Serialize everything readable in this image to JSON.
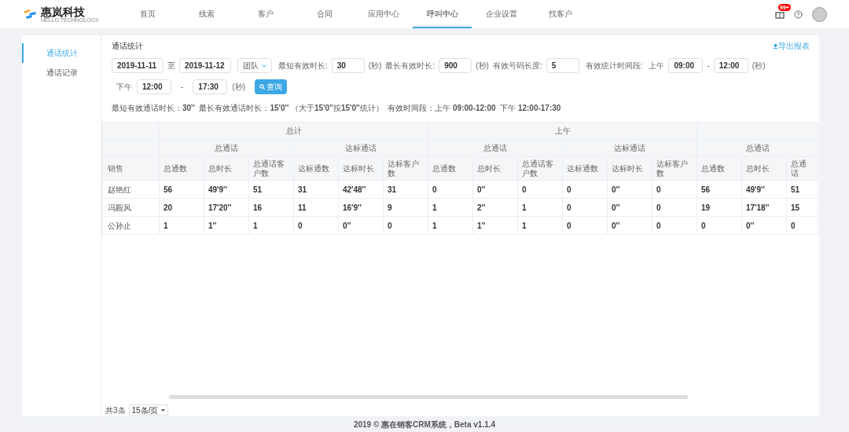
{
  "logo": {
    "name": "惠岚科技",
    "tagline": "HELLO TECHNOLOGY"
  },
  "nav": [
    {
      "label": "首页",
      "selected": false
    },
    {
      "label": "线索",
      "selected": false
    },
    {
      "label": "客户",
      "selected": false
    },
    {
      "label": "合同",
      "selected": false
    },
    {
      "label": "应用中心",
      "selected": false
    },
    {
      "label": "呼叫中心",
      "selected": true
    },
    {
      "label": "企业设置",
      "selected": false
    },
    {
      "label": "找客户",
      "selected": false
    }
  ],
  "notification_badge": "99+",
  "sidebar": [
    {
      "label": "通话统计",
      "selected": true
    },
    {
      "label": "通话记录",
      "selected": false
    }
  ],
  "page_title": "通话统计",
  "export_link": "导出报表",
  "filters": {
    "date_from": "2019-11-11",
    "date_sep": "至",
    "date_to": "2019-11-12",
    "scope": "团队",
    "min_label": "最短有效时长:",
    "min_value": "30",
    "min_unit": "(秒)",
    "max_label": "最长有效时长:",
    "max_value": "900",
    "max_unit": "(秒)",
    "len_label": "有效号码长度:",
    "len_value": "5",
    "period_label": "有效统计时间段:",
    "am_label": "上午",
    "am_from": "09:00",
    "am_sep": "-",
    "am_to": "12:00",
    "am_unit": "(秒)",
    "pm_label": "下午",
    "pm_from": "12:00",
    "pm_sep": "-",
    "pm_to": "17:30",
    "pm_unit": "(秒)",
    "query_button": "查询"
  },
  "summary": "最短有效通话时长：**30''**  最长有效通话时长：**15'0''** （大于**15'0''**按**15'0''**统计）  有效时间段：上午 **09:00-12:00**  下午 **12:00-17:30**",
  "table": {
    "first_column": "销售",
    "groups": [
      {
        "label": "总计",
        "subgroups": [
          {
            "label": "总通话",
            "columns": [
              "总通数",
              "总时长",
              "总通话客户数"
            ]
          },
          {
            "label": "达标通话",
            "columns": [
              "达标通数",
              "达标时长",
              "达标客户数"
            ]
          }
        ]
      },
      {
        "label": "上午",
        "subgroups": [
          {
            "label": "总通话",
            "columns": [
              "总通数",
              "总时长",
              "总通话客户数"
            ]
          },
          {
            "label": "达标通话",
            "columns": [
              "达标通数",
              "达标时长",
              "达标客户数"
            ]
          }
        ]
      },
      {
        "subgroups": [
          {
            "label": "总通话",
            "columns": [
              "总通数",
              "总时长",
              "总通话"
            ]
          }
        ]
      }
    ],
    "rows": [
      {
        "name": "赵艳红",
        "cells": [
          "56",
          "49'9''",
          "51",
          "31",
          "42'48''",
          "31",
          "0",
          "0''",
          "0",
          "0",
          "0''",
          "0",
          "56",
          "49'9''",
          "51"
        ]
      },
      {
        "name": "冯殿风",
        "cells": [
          "20",
          "17'20''",
          "16",
          "11",
          "16'9''",
          "9",
          "1",
          "2''",
          "1",
          "0",
          "0''",
          "0",
          "19",
          "17'18''",
          "15"
        ]
      },
      {
        "name": "公孙止",
        "cells": [
          "1",
          "1''",
          "1",
          "0",
          "0''",
          "0",
          "1",
          "1''",
          "1",
          "0",
          "0''",
          "0",
          "0",
          "0''",
          "0"
        ]
      }
    ]
  },
  "pagination": {
    "total": "共3条",
    "page_size": "15条/页"
  },
  "footer": "2019 © 惠在销客CRM系统，Beta v1.1.4"
}
